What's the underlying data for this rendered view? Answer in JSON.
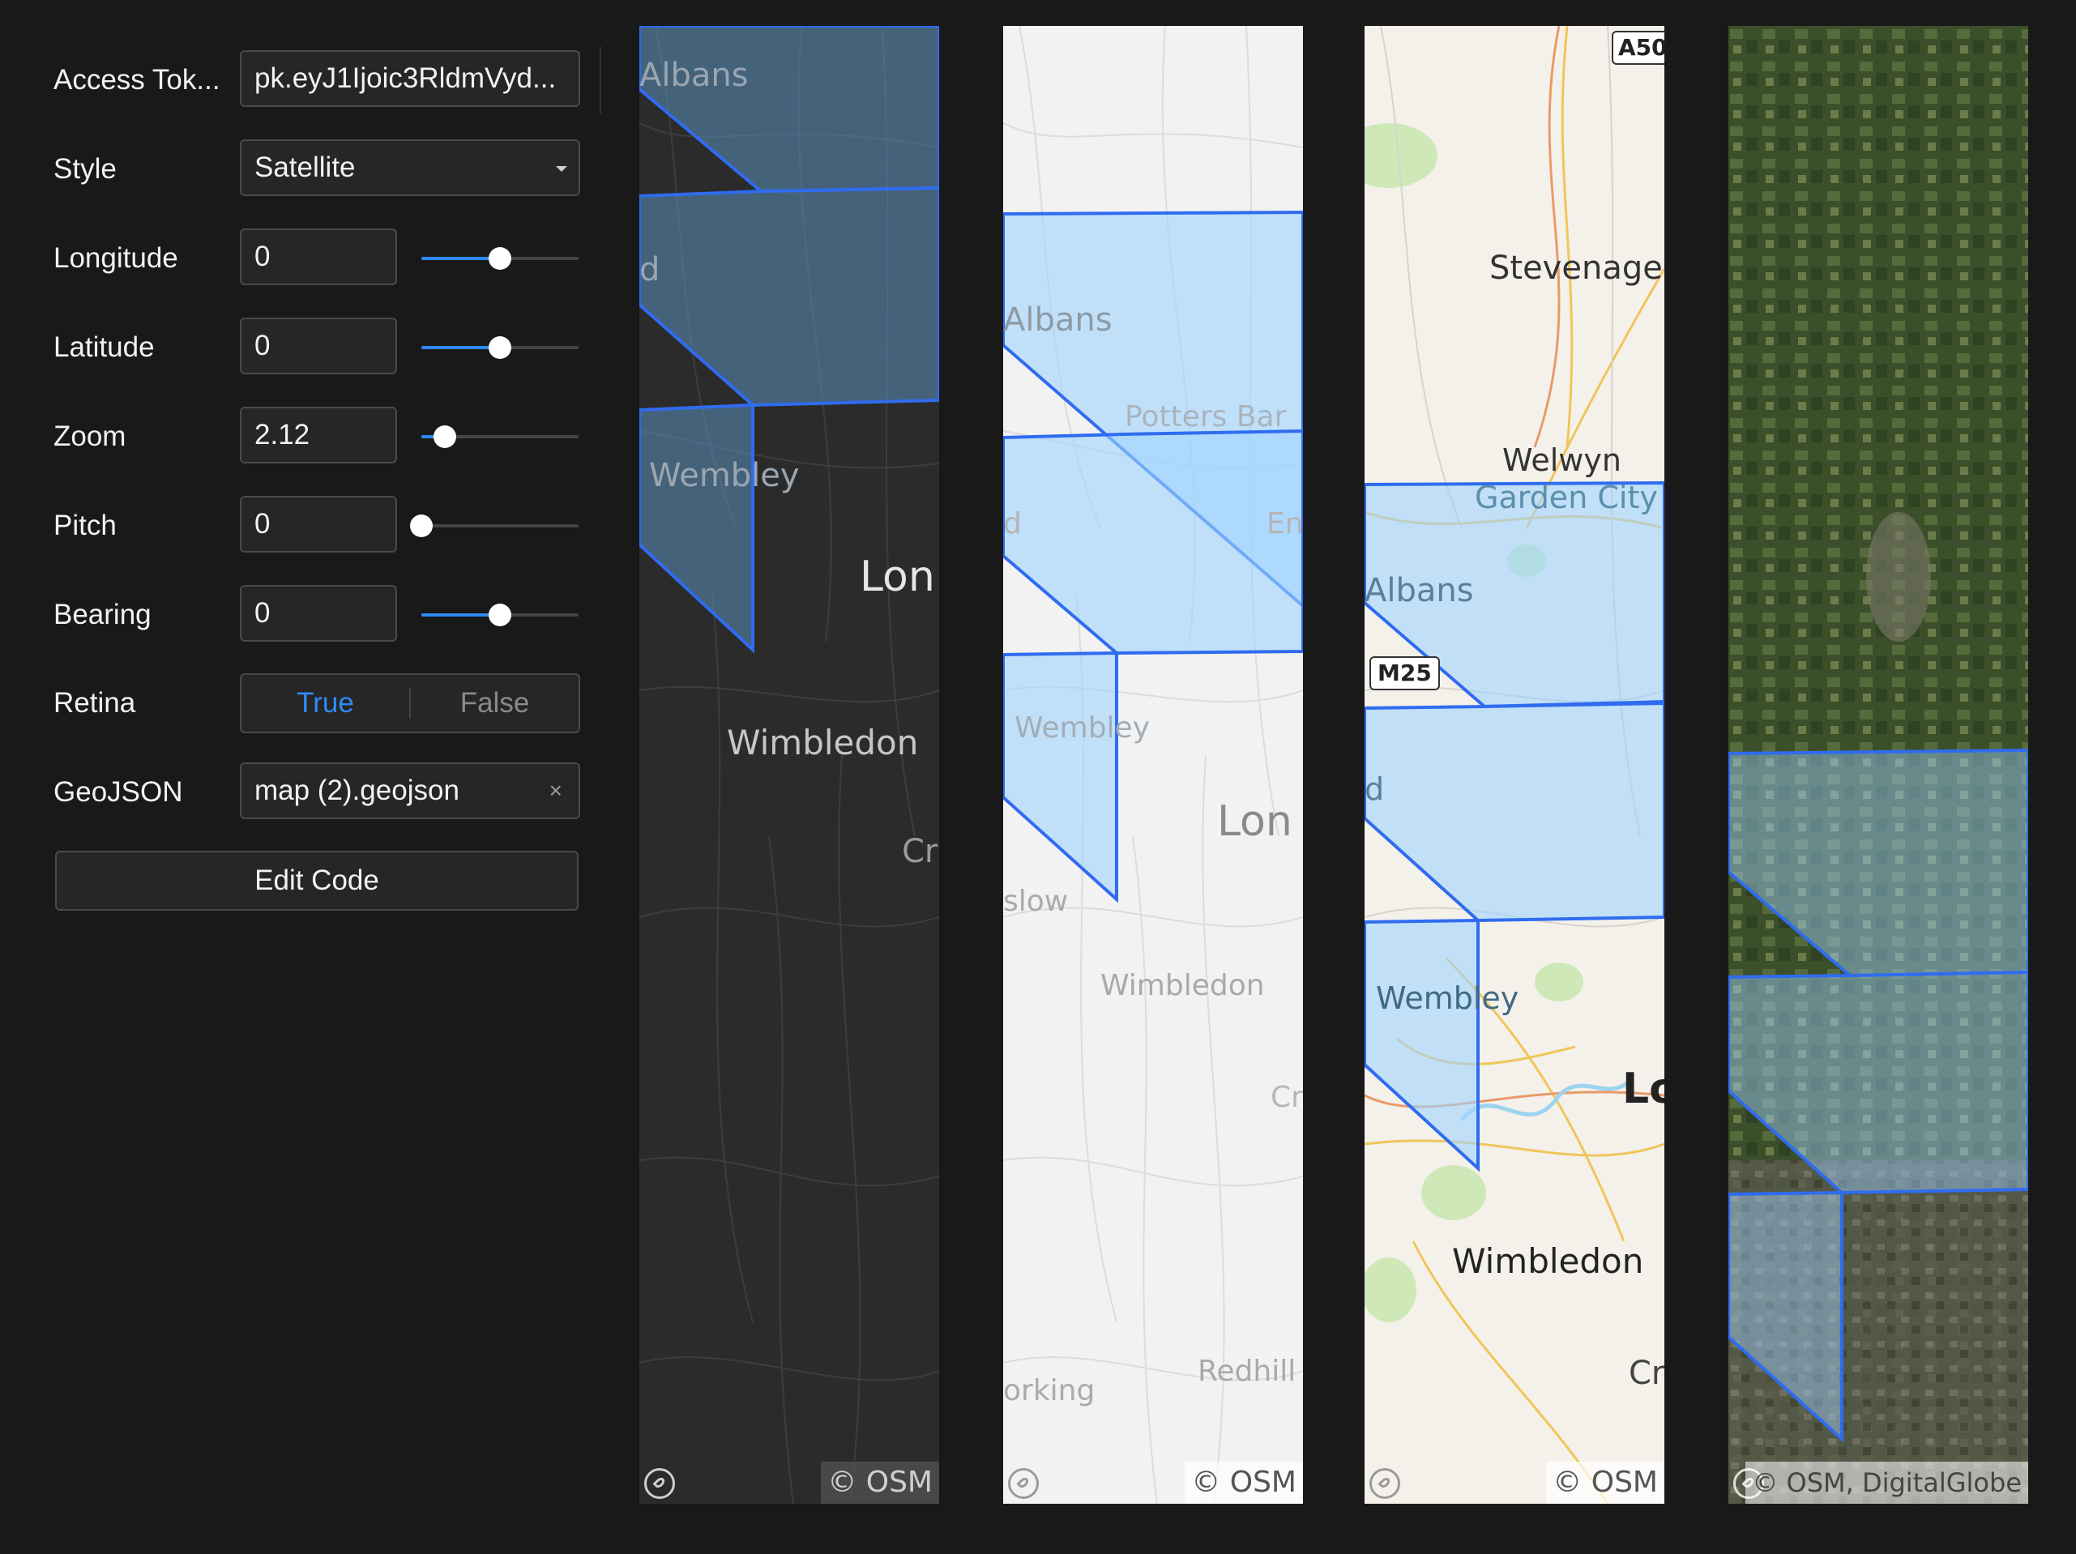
{
  "controls": {
    "access_token": {
      "label": "Access Tok...",
      "value": "pk.eyJ1Ijoic3RldmVyd..."
    },
    "style": {
      "label": "Style",
      "value": "Satellite"
    },
    "longitude": {
      "label": "Longitude",
      "value": "0",
      "slider_fraction": 0.5
    },
    "latitude": {
      "label": "Latitude",
      "value": "0",
      "slider_fraction": 0.5
    },
    "zoom": {
      "label": "Zoom",
      "value": "2.12",
      "slider_fraction": 0.15
    },
    "pitch": {
      "label": "Pitch",
      "value": "0",
      "slider_fraction": 0.0
    },
    "bearing": {
      "label": "Bearing",
      "value": "0",
      "slider_fraction": 0.5
    },
    "retina": {
      "label": "Retina",
      "options": [
        "True",
        "False"
      ],
      "selected": "True"
    },
    "geojson": {
      "label": "GeoJSON",
      "value": "map (2).geojson",
      "clear": "×"
    },
    "edit_code": "Edit Code"
  },
  "maps": [
    {
      "style": "dark",
      "labels": [
        "Albans",
        "d",
        "Wembley",
        "Lon",
        "Wimbledon",
        "Cr"
      ],
      "attribution": "© OSM"
    },
    {
      "style": "light",
      "labels": [
        "Albans",
        "Potters Bar",
        "En",
        "d",
        "Wembley",
        "Lon",
        "slow",
        "Wimbledon",
        "Cr",
        "Redhill",
        "orking"
      ],
      "attribution": "© OSM"
    },
    {
      "style": "streets",
      "labels": [
        "A50",
        "Stevenage",
        "Welwyn",
        "Garden City",
        "Albans",
        "M25",
        "d",
        "Wembley",
        "Lon",
        "Wimbledon",
        "Cr"
      ],
      "attribution": "© OSM"
    },
    {
      "style": "satellite",
      "labels": [],
      "attribution": "© OSM, DigitalGlobe"
    }
  ],
  "colors": {
    "accent": "#2d8bf7",
    "polygon_stroke": "#2f6cf0",
    "polygon_fill": "#9fd3ff",
    "background": "#191919"
  }
}
